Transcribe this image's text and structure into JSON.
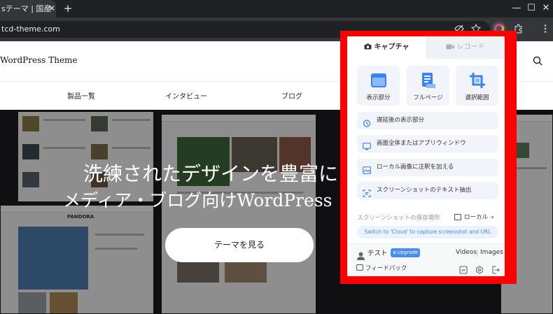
{
  "browser": {
    "tab_title": "sテーマ | 国産",
    "tab_close": "✕",
    "new_tab": "+",
    "address": "tcd-theme.com",
    "window_controls": [
      "—",
      "☐",
      "✕"
    ]
  },
  "site": {
    "logo": "WordPress Theme",
    "nav": [
      "製品一覧",
      "インタビュー",
      "ブログ"
    ],
    "hero_line1": "洗練されたデザインを豊富に",
    "hero_line2_ja": "メディア・ブログ向け",
    "hero_line2_en": "WordPress",
    "hero_button": "テーマを見る",
    "shot_logo": "PANDORA"
  },
  "popup": {
    "tab_capture": "キャプチャ",
    "tab_record": "レコード",
    "tiles": [
      {
        "label": "表示部分",
        "icon": "browser-window-icon"
      },
      {
        "label": "フルページ",
        "icon": "full-page-icon"
      },
      {
        "label": "選択範囲",
        "icon": "crop-select-icon"
      }
    ],
    "options": [
      {
        "label": "遅延後の表示部分",
        "icon": "timer-icon"
      },
      {
        "label": "画面全体またはアプリウィンドウ",
        "icon": "monitor-icon"
      },
      {
        "label": "ローカル画像に注釈を加える",
        "icon": "image-annotate-icon"
      },
      {
        "label": "スクリーンショットのテキスト抽出",
        "icon": "text-extract-icon"
      }
    ],
    "save_label": "スクリーンショットの保存場所",
    "save_value": "ローカル",
    "save_caret": "▾",
    "cloud_text": "Switch to 'Cloud' to capture screenshot and URL",
    "user": "テスト",
    "upgrade": "Upgrade",
    "videos": "Videos",
    "images": "Images",
    "feedback": "フィードバック"
  },
  "colors": {
    "highlight": "#ff0000",
    "accent": "#4a8df0",
    "icon_blue": "#3b82f6"
  }
}
